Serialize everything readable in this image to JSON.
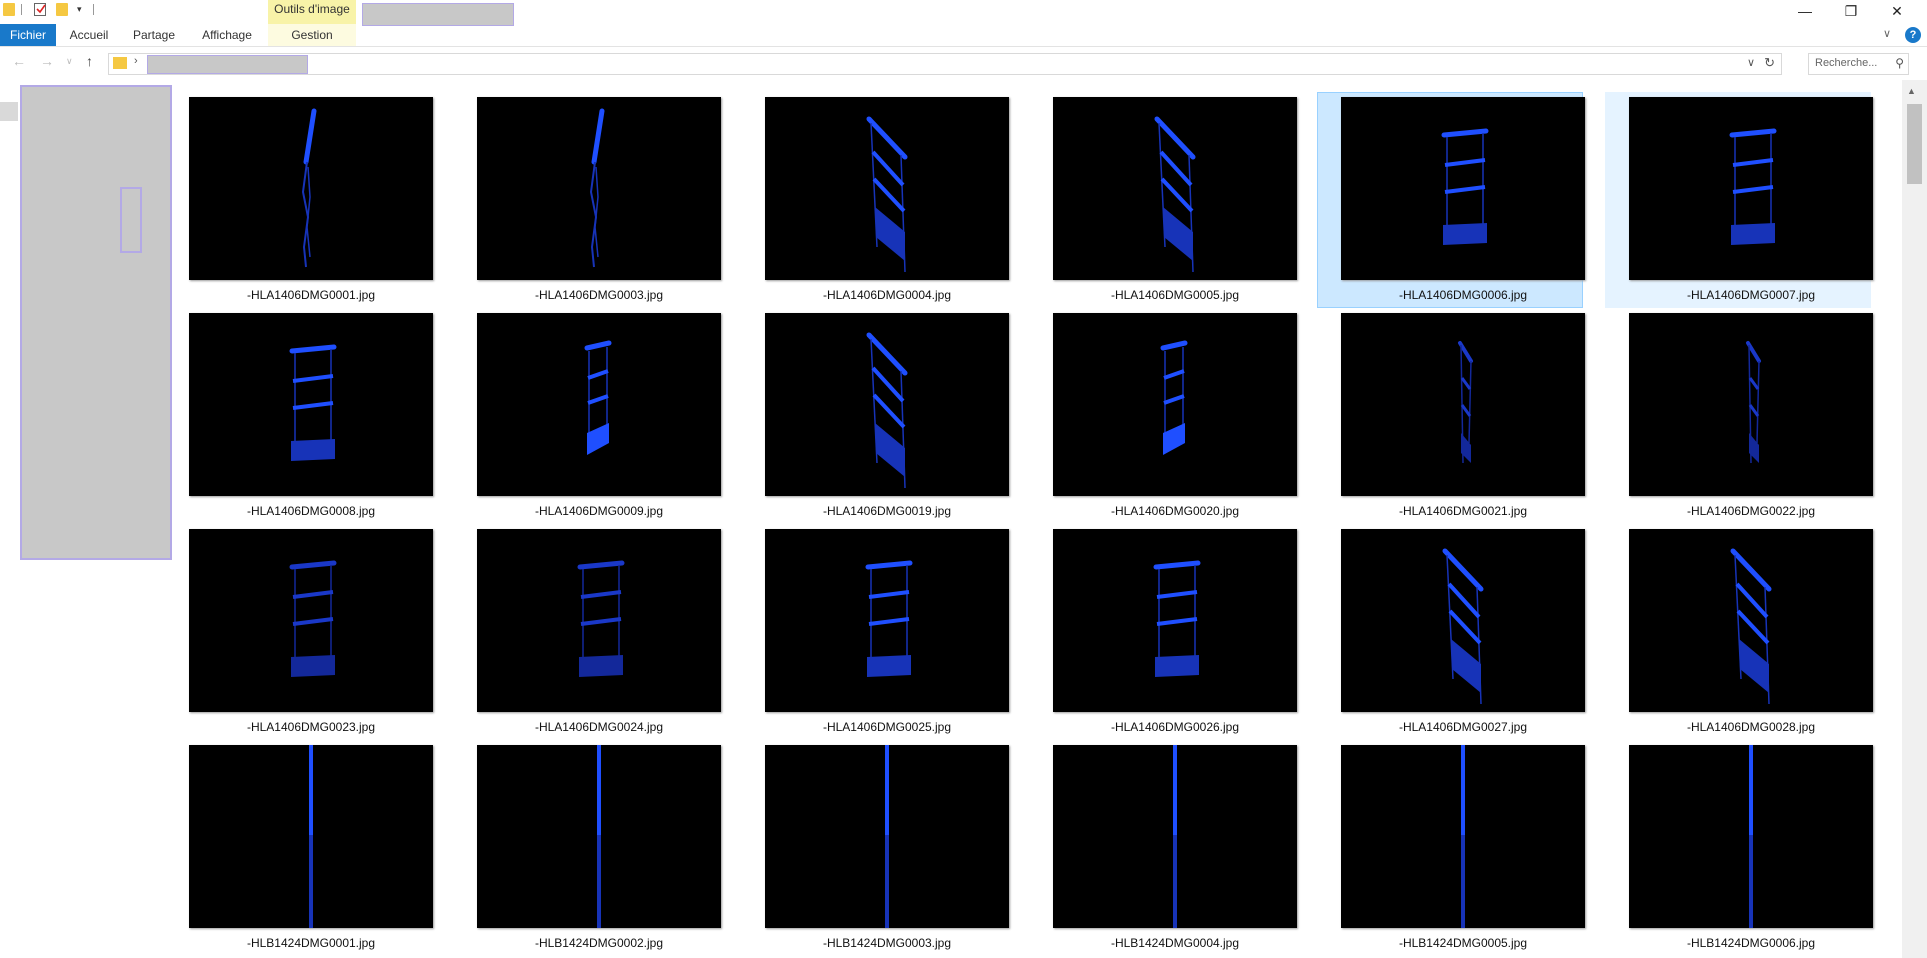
{
  "titlebar": {
    "context_tab": "Outils d'image",
    "window_controls": [
      "minimize-icon",
      "restore-icon",
      "close-icon"
    ]
  },
  "ribbon": {
    "tabs": [
      {
        "label": "Fichier"
      },
      {
        "label": "Accueil"
      },
      {
        "label": "Partage"
      },
      {
        "label": "Affichage"
      },
      {
        "label": "Gestion"
      }
    ],
    "help_label": "?"
  },
  "address": {
    "search_placeholder": "Recherche..."
  },
  "colors": {
    "accent": "#1979ca",
    "selection": "#cce8ff",
    "model_blue": "#1f4fff"
  },
  "files": [
    {
      "name": "-HLA1406DMG0001.jpg",
      "variant": "edge"
    },
    {
      "name": "-HLA1406DMG0003.jpg",
      "variant": "edge"
    },
    {
      "name": "-HLA1406DMG0004.jpg",
      "variant": "angled"
    },
    {
      "name": "-HLA1406DMG0005.jpg",
      "variant": "angled"
    },
    {
      "name": "-HLA1406DMG0006.jpg",
      "variant": "front",
      "state": "selected"
    },
    {
      "name": "-HLA1406DMG0007.jpg",
      "variant": "front",
      "state": "hover"
    },
    {
      "name": "-HLA1406DMG0008.jpg",
      "variant": "front"
    },
    {
      "name": "-HLA1406DMG0009.jpg",
      "variant": "small"
    },
    {
      "name": "-HLA1406DMG0019.jpg",
      "variant": "angled"
    },
    {
      "name": "-HLA1406DMG0020.jpg",
      "variant": "small"
    },
    {
      "name": "-HLA1406DMG0021.jpg",
      "variant": "small-dark"
    },
    {
      "name": "-HLA1406DMG0022.jpg",
      "variant": "small-dark"
    },
    {
      "name": "-HLA1406DMG0023.jpg",
      "variant": "front-dark"
    },
    {
      "name": "-HLA1406DMG0024.jpg",
      "variant": "front-dark"
    },
    {
      "name": "-HLA1406DMG0025.jpg",
      "variant": "front"
    },
    {
      "name": "-HLA1406DMG0026.jpg",
      "variant": "front"
    },
    {
      "name": "-HLA1406DMG0027.jpg",
      "variant": "angled"
    },
    {
      "name": "-HLA1406DMG0028.jpg",
      "variant": "angled"
    },
    {
      "name": "-HLB1424DMG0001.jpg",
      "variant": "pole"
    },
    {
      "name": "-HLB1424DMG0002.jpg",
      "variant": "pole"
    },
    {
      "name": "-HLB1424DMG0003.jpg",
      "variant": "pole"
    },
    {
      "name": "-HLB1424DMG0004.jpg",
      "variant": "pole"
    },
    {
      "name": "-HLB1424DMG0005.jpg",
      "variant": "pole"
    },
    {
      "name": "-HLB1424DMG0006.jpg",
      "variant": "pole"
    }
  ]
}
